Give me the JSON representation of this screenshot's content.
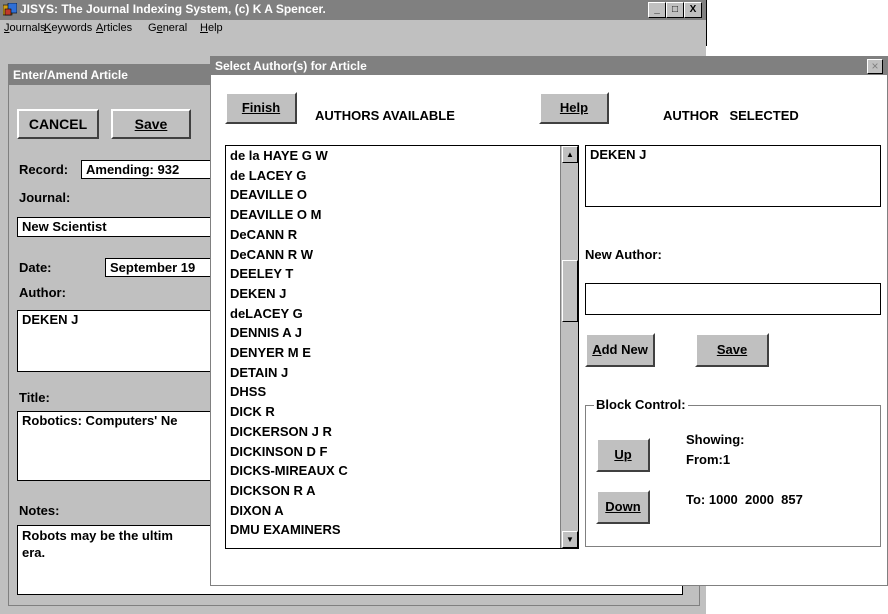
{
  "main_window": {
    "title": "JISYS: The Journal Indexing System, (c) K A Spencer.",
    "menu": [
      {
        "label": "Journals",
        "mnemonic_index": 0
      },
      {
        "label": "Keywords",
        "mnemonic_index": 0
      },
      {
        "label": "Articles",
        "mnemonic_index": 0
      },
      {
        "label": "General",
        "mnemonic_index": 1
      },
      {
        "label": "Help",
        "mnemonic_index": 0
      }
    ],
    "caption_buttons": {
      "minimize": "_",
      "maximize": "□",
      "close": "X"
    }
  },
  "amend_window": {
    "title": "Enter/Amend Article",
    "cancel_label": "CANCEL",
    "save_label": "Save",
    "record_label": "Record:",
    "record_value": "Amending: 932",
    "journal_label": "Journal:",
    "journal_value": "New Scientist",
    "date_label": "Date:",
    "date_value": "September 19",
    "author_label": "Author:",
    "author_value": "DEKEN J",
    "title_label": "Title:",
    "title_value": "Robotics: Computers' Ne",
    "notes_label": "Notes:",
    "notes_line1": "Robots may be the ultim",
    "notes_line2": "era."
  },
  "dialog": {
    "title": "Select Author(s) for Article",
    "close_glyph": "×",
    "finish_label": "Finish",
    "authors_available_label": "AUTHORS AVAILABLE",
    "help_label": "Help",
    "author_selected_label": "AUTHOR   SELECTED",
    "selected_authors": [
      "DEKEN J"
    ],
    "new_author_label": "New Author:",
    "new_author_value": "",
    "add_new_label": "Add New",
    "save_label": "Save",
    "block_control_label": "Block Control:",
    "up_label": "Up",
    "down_label": "Down",
    "showing_label": "Showing:",
    "from_text": "From:1",
    "to_text": "To: 1000  2000  857",
    "authors": [
      "de la HAYE G W",
      "de LACEY G",
      "DEAVILLE O",
      "DEAVILLE O M",
      "DeCANN R",
      "DeCANN R W",
      "DEELEY T",
      "DEKEN J",
      "deLACEY G",
      "DENNIS A J",
      "DENYER M E",
      "DETAIN J",
      "DHSS",
      "DICK R",
      "DICKERSON J R",
      "DICKINSON D F",
      "DICKS-MIREAUX C",
      "DICKSON R A",
      "DIXON A",
      "DMU EXAMINERS"
    ]
  }
}
